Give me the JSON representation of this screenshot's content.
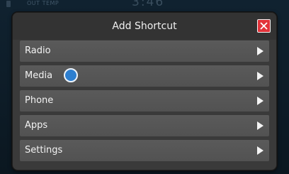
{
  "status": {
    "temp_label": "OUT TEMP",
    "clock": "3:46"
  },
  "dialog": {
    "title": "Add Shortcut",
    "close_icon": "close-x-icon"
  },
  "menu": {
    "items": [
      {
        "label": "Radio",
        "icon": "chevron-right-icon"
      },
      {
        "label": "Media",
        "icon": "chevron-right-icon"
      },
      {
        "label": "Phone",
        "icon": "chevron-right-icon"
      },
      {
        "label": "Apps",
        "icon": "chevron-right-icon"
      },
      {
        "label": "Settings",
        "icon": "chevron-right-icon"
      }
    ]
  },
  "colors": {
    "close_button": "#e2333a",
    "menu_item_bg": "#555555",
    "dialog_bg": "#3a3a3a",
    "touch_indicator": "#2d7fd0"
  }
}
